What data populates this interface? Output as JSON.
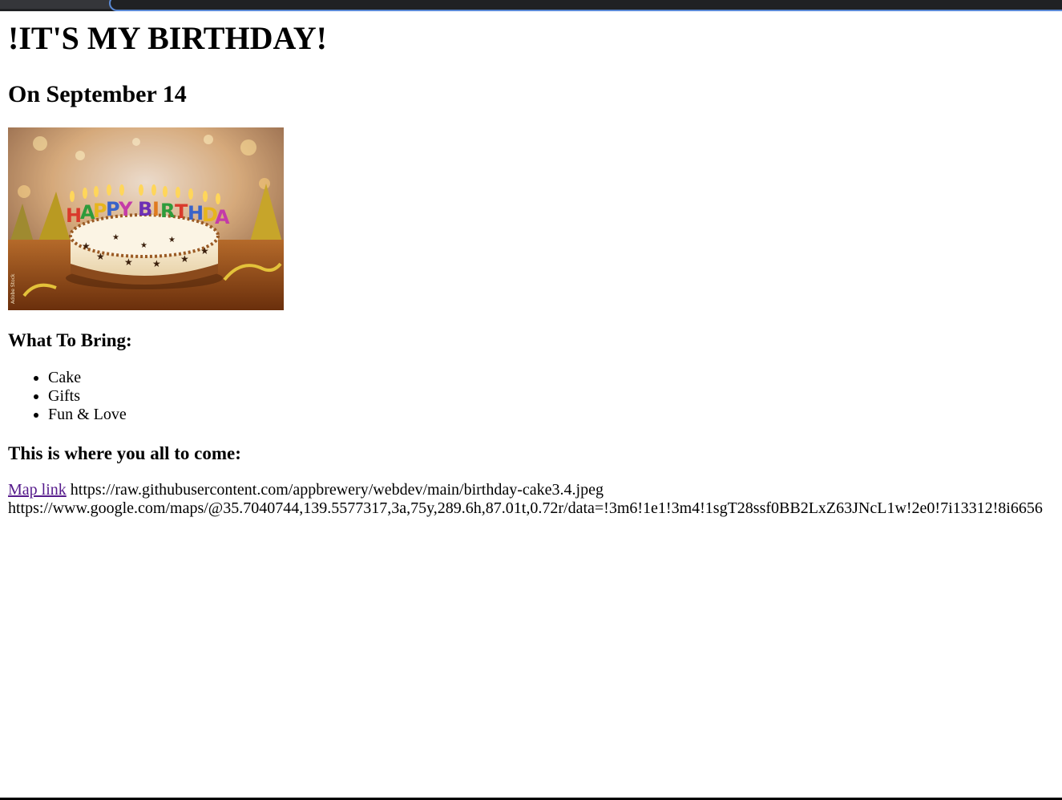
{
  "page": {
    "title": "!IT'S MY BIRTHDAY!",
    "date": "On September 14",
    "image_alt": "Happy birthday cake with candles",
    "bring_heading": "What To Bring:",
    "bring_items": [
      "Cake",
      "Gifts",
      "Fun & Love"
    ],
    "where_heading": "This is where you all to come:",
    "map_link_text": "Map link",
    "cake_url_text": "https://raw.githubusercontent.com/appbrewery/webdev/main/birthday-cake3.4.jpeg",
    "maps_url_text": "https://www.google.com/maps/@35.7040744,139.5577317,3a,75y,289.6h,87.01t,0.72r/data=!3m6!1e1!3m4!1sgT28ssf0BB2LxZ63JNcL1w!2e0!7i13312!8i6656"
  },
  "colors": {
    "visited_link": "#551a8b",
    "text": "#000000",
    "background": "#ffffff"
  }
}
